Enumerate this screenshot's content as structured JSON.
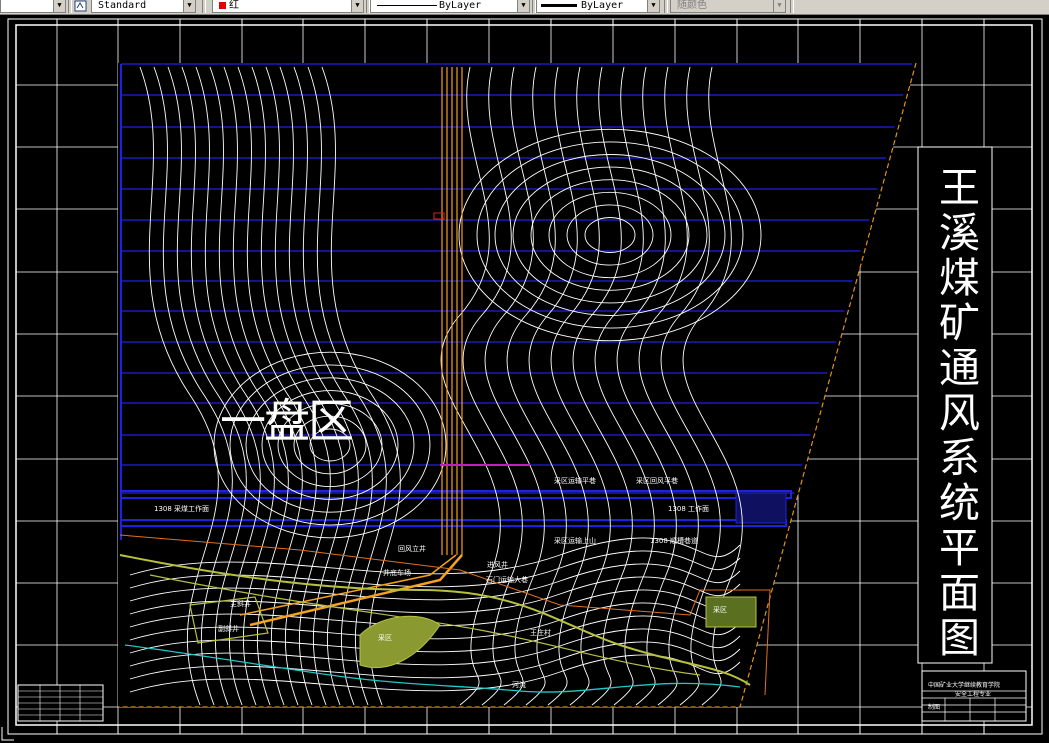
{
  "toolbar": {
    "textstyle_value": "Standard",
    "color_value": "红",
    "linetype_value": "ByLayer",
    "lineweight_value": "ByLayer",
    "plotstyle_value": "随颜色"
  },
  "drawing": {
    "title": "王溪煤矿通风系统平面图",
    "area_label": "一盘区",
    "labels": {
      "face_1": "1308 采煤工作面",
      "face_2": "1308 工作面",
      "roadway_1": "采区运输平巷",
      "roadway_2": "采区回风平巷",
      "roadway_3": "采区运输上山",
      "roadway_4": "1308 顺槽巷道",
      "shaft_1": "回风立井",
      "shaft_2": "进风井",
      "shaft_3": "主斜井",
      "shaft_4": "副斜井",
      "yard": "井底车场",
      "cross": "石门运输大巷",
      "pit_1": "采区",
      "pit_2": "采区",
      "village": "王庄村",
      "river": "河流"
    },
    "title_block": {
      "org": "中国矿业大学继续教育学院",
      "dept": "安全工程专业",
      "drawn": "制图"
    }
  },
  "colors": {
    "background": "#000000",
    "contour": "#ffffff",
    "boundary": "#2020e0",
    "shaft": "#f4a020",
    "roadway": "#b8c040",
    "river": "#20c8c8",
    "grid": "#ffffff"
  }
}
